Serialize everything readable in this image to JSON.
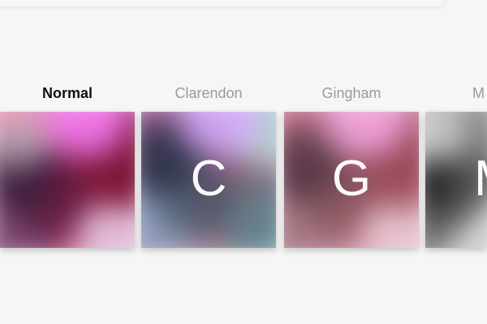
{
  "filters": {
    "items": [
      {
        "name": "Normal",
        "letter": "",
        "selected": true
      },
      {
        "name": "Clarendon",
        "letter": "C",
        "selected": false
      },
      {
        "name": "Gingham",
        "letter": "G",
        "selected": false
      },
      {
        "name": "M",
        "letter": "M",
        "selected": false
      }
    ]
  },
  "colors": {
    "background": "#f6f6f6",
    "selected_label": "#111111",
    "unselected_label": "#9a9a9a",
    "thumbnail_letter": "#ffffff"
  }
}
